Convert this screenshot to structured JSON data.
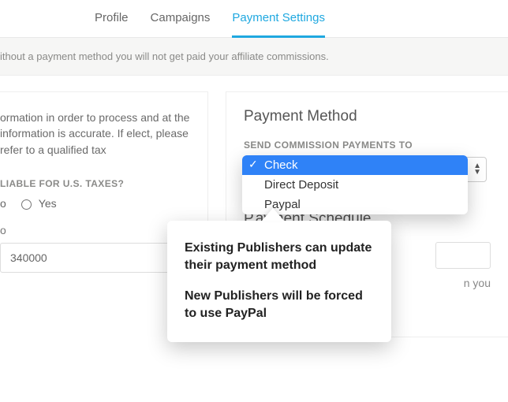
{
  "tabs": {
    "profile": "Profile",
    "campaigns": "Campaigns",
    "payment_settings": "Payment Settings"
  },
  "notice": "ithout a payment method you will not get paid your affiliate commissions.",
  "left": {
    "body": "ormation in order to process and at the information is accurate. If elect, please refer to a qualified tax",
    "tax_q": "LIABLE FOR U.S. TAXES?",
    "opt_no": "o",
    "opt_yes": "Yes",
    "sub_label": "o",
    "input_value": "340000"
  },
  "right": {
    "payment_method_title": "Payment Method",
    "send_to_label": "SEND COMMISSION PAYMENTS TO",
    "options": {
      "check": "Check",
      "direct_deposit": "Direct Deposit",
      "paypal": "Paypal"
    },
    "schedule_title": "Payment Schedule",
    "schedule_prefix": "P",
    "schedule_note_suffix": "n you"
  },
  "bubble": {
    "p1": "Existing Publishers can update their payment method",
    "p2": "New Publishers will be forced to use PayPal"
  }
}
